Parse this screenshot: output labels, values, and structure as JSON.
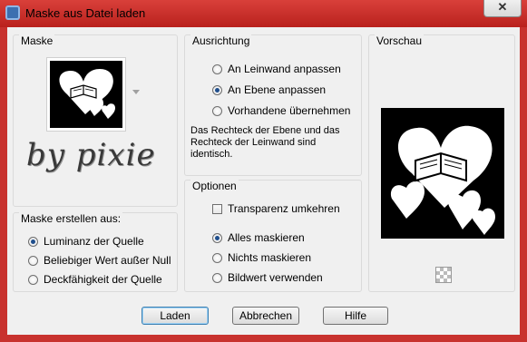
{
  "window": {
    "title": "Maske aus Datei laden",
    "close_symbol": "✕",
    "app_icon": "app-icon"
  },
  "mask_group": {
    "title": "Maske",
    "thumbnail": "mask-heart-book-icon",
    "dropdown_icon": "dropdown-arrow-icon",
    "signature_text": "by pixie"
  },
  "create_group": {
    "title": "Maske erstellen aus:",
    "options": [
      "Luminanz der Quelle",
      "Beliebiger Wert außer Null",
      "Deckfähigkeit der Quelle"
    ],
    "selected_index": 0
  },
  "orientation_group": {
    "title": "Ausrichtung",
    "options": [
      "An Leinwand anpassen",
      "An Ebene anpassen",
      "Vorhandene übernehmen"
    ],
    "selected_index": 1,
    "description": [
      "Das Rechteck der Ebene und das",
      "Rechteck der Leinwand sind",
      "identisch."
    ]
  },
  "options_group": {
    "title": "Optionen",
    "invert_label": "Transparenz umkehren",
    "invert_checked": false,
    "mask_options": [
      "Alles maskieren",
      "Nichts maskieren",
      "Bildwert verwenden"
    ],
    "selected_index": 0
  },
  "preview_group": {
    "title": "Vorschau",
    "image": "preview-heart-book-icon",
    "transparency_icon": "checkerboard-icon"
  },
  "buttons": {
    "load": "Laden",
    "cancel": "Abbrechen",
    "help": "Hilfe"
  }
}
